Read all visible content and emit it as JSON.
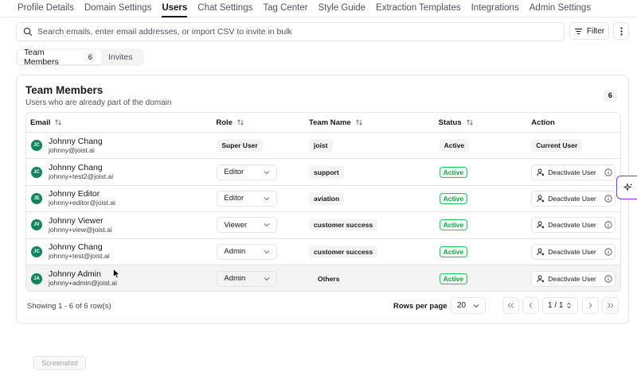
{
  "nav": {
    "tabs": [
      {
        "label": "Profile Details"
      },
      {
        "label": "Domain Settings"
      },
      {
        "label": "Users"
      },
      {
        "label": "Chat Settings"
      },
      {
        "label": "Tag Center"
      },
      {
        "label": "Style Guide"
      },
      {
        "label": "Extraction Templates"
      },
      {
        "label": "Integrations"
      },
      {
        "label": "Admin Settings"
      }
    ],
    "active": "Users"
  },
  "search": {
    "placeholder": "Search emails, enter email addresses, or import CSV to invite in bulk"
  },
  "toolbar": {
    "filter_label": "Filter",
    "more_icon": "more-vertical-icon"
  },
  "segment": {
    "members_label": "Team Members",
    "members_count": "6",
    "invites_label": "Invites"
  },
  "card": {
    "title": "Team Members",
    "subtitle": "Users who are already part of the domain",
    "count": "6"
  },
  "table": {
    "headers": {
      "email": "Email",
      "role": "Role",
      "team": "Team Name",
      "status": "Status",
      "action": "Action"
    },
    "rows": [
      {
        "initials": "JC",
        "name": "Johnny Chang",
        "email": "johnny@joist.ai",
        "role": "Super User",
        "team": "joist",
        "status": "Active",
        "action": "Current User"
      },
      {
        "initials": "JC",
        "name": "Johnny Chang",
        "email": "johnny+test2@joist.ai",
        "role": "Editor",
        "team": "support",
        "status": "Active",
        "action": "Deactivate User"
      },
      {
        "initials": "JE",
        "name": "Johnny Editor",
        "email": "johnny+editor@joist.ai",
        "role": "Editor",
        "team": "aviation",
        "status": "Active",
        "action": "Deactivate User"
      },
      {
        "initials": "JV",
        "name": "Johnny Viewer",
        "email": "johnny+view@joist.ai",
        "role": "Viewer",
        "team": "customer success",
        "status": "Active",
        "action": "Deactivate User"
      },
      {
        "initials": "JC",
        "name": "Johnny Chang",
        "email": "johnny+test@joist.ai",
        "role": "Admin",
        "team": "customer success",
        "status": "Active",
        "action": "Deactivate User"
      },
      {
        "initials": "JA",
        "name": "Johnny Admin",
        "email": "johnny+admin@joist.ai",
        "role": "Admin",
        "team": "Others",
        "status": "Active",
        "action": "Deactivate User"
      }
    ]
  },
  "footer": {
    "showing": "Showing 1 - 6 of 6 row(s)",
    "rows_per_page_label": "Rows per page",
    "rows_per_page": "20",
    "page": "1 / 1"
  },
  "watermark": "Screenshot",
  "colors": {
    "avatar": "#10845f",
    "active_border": "#22c55e",
    "spark": "#7c3aed"
  }
}
